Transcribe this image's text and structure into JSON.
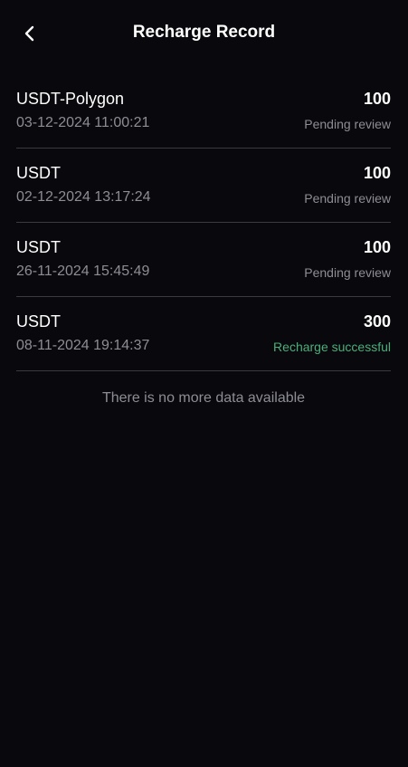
{
  "header": {
    "title": "Recharge Record",
    "back_icon": "chevron-left-icon"
  },
  "records": [
    {
      "name": "USDT-Polygon",
      "time": "03-12-2024 11:00:21",
      "amount": "100",
      "status": "Pending review",
      "status_type": "pending"
    },
    {
      "name": "USDT",
      "time": "02-12-2024 13:17:24",
      "amount": "100",
      "status": "Pending review",
      "status_type": "pending"
    },
    {
      "name": "USDT",
      "time": "26-11-2024 15:45:49",
      "amount": "100",
      "status": "Pending review",
      "status_type": "pending"
    },
    {
      "name": "USDT",
      "time": "08-11-2024 19:14:37",
      "amount": "300",
      "status": "Recharge successful",
      "status_type": "success"
    }
  ],
  "footer": {
    "no_more_text": "There is no more data available"
  },
  "colors": {
    "background": "#08080d",
    "muted_text": "#8d8d94",
    "success": "#4caf7a",
    "divider": "#3a3a40"
  }
}
